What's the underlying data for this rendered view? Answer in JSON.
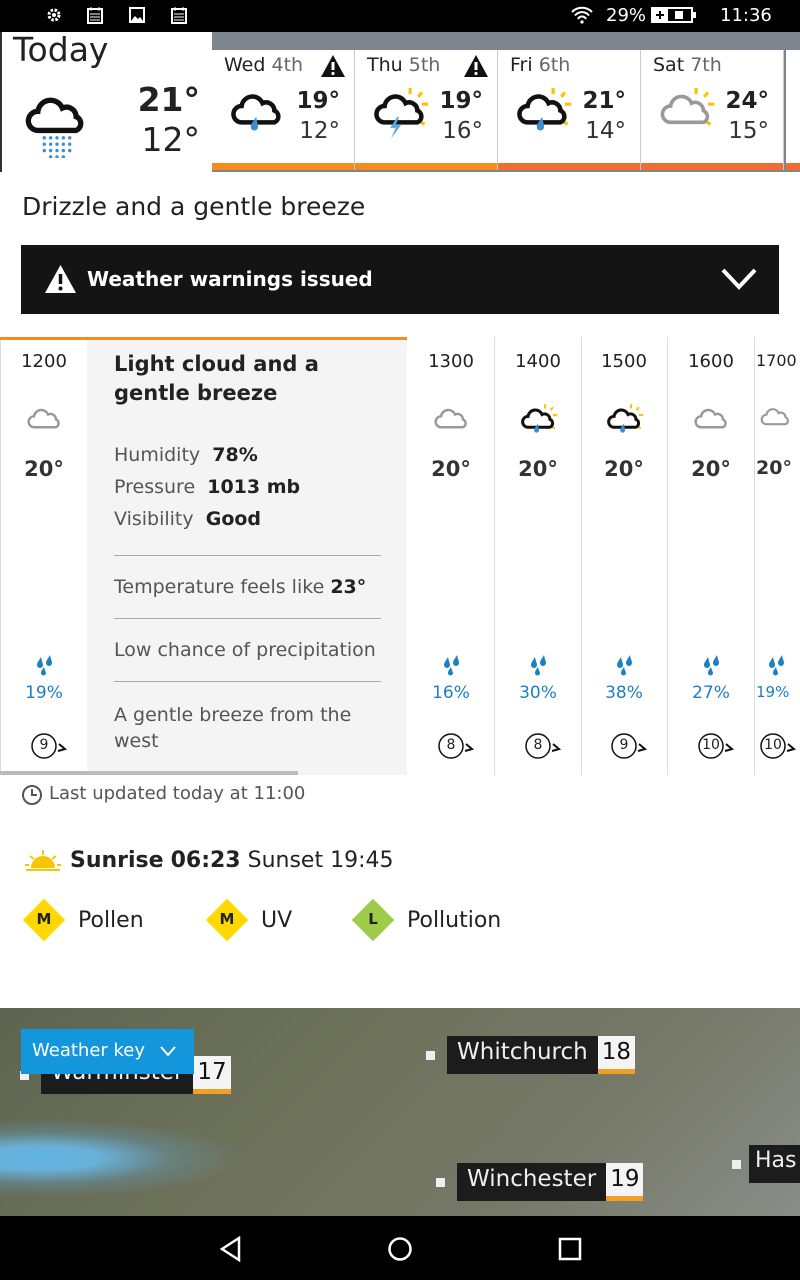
{
  "status_bar": {
    "icons": [
      "gear-icon",
      "calendar-icon",
      "image-icon",
      "calendar-icon"
    ],
    "battery": "29%",
    "time": "11:36"
  },
  "today": {
    "label": "Today",
    "high": "21°",
    "low": "12°",
    "icon": "drizzle"
  },
  "days": [
    {
      "day": "Wed",
      "date": "4th",
      "high": "19°",
      "low": "12°",
      "icon": "light-rain",
      "warning": true,
      "bar_color": "#f58b1f"
    },
    {
      "day": "Thu",
      "date": "5th",
      "high": "19°",
      "low": "16°",
      "icon": "thunder-sun",
      "warning": true,
      "bar_color": "#f58b1f"
    },
    {
      "day": "Fri",
      "date": "6th",
      "high": "21°",
      "low": "14°",
      "icon": "rain-sun",
      "warning": false,
      "bar_color": "#f26b30"
    },
    {
      "day": "Sat",
      "date": "7th",
      "high": "24°",
      "low": "15°",
      "icon": "cloud-sun",
      "warning": false,
      "bar_color": "#f26b30"
    }
  ],
  "summary": "Drizzle and a gentle breeze",
  "warning_bar": {
    "label": "Weather warnings issued"
  },
  "hourly": [
    {
      "time": "1200",
      "temp": "20°",
      "precip": "19%",
      "wind": "9",
      "icon": "cloud"
    },
    {
      "time": "1300",
      "temp": "20°",
      "precip": "16%",
      "wind": "8",
      "icon": "cloud"
    },
    {
      "time": "1400",
      "temp": "20°",
      "precip": "30%",
      "wind": "8",
      "icon": "rain-sun"
    },
    {
      "time": "1500",
      "temp": "20°",
      "precip": "38%",
      "wind": "9",
      "icon": "rain-sun"
    },
    {
      "time": "1600",
      "temp": "20°",
      "precip": "27%",
      "wind": "10",
      "icon": "cloud"
    },
    {
      "time": "1700",
      "temp": "20°",
      "precip": "19%",
      "wind": "10",
      "icon": "cloud"
    }
  ],
  "detail": {
    "title": "Light cloud and a gentle breeze",
    "humidity_label": "Humidity",
    "humidity": "78%",
    "pressure_label": "Pressure",
    "pressure": "1013 mb",
    "visibility_label": "Visibility",
    "visibility": "Good",
    "feels_label": "Temperature feels like",
    "feels": "23°",
    "precip_text": "Low chance of precipitation",
    "wind_text": "A gentle breeze from the west"
  },
  "last_updated": "Last updated today at 11:00",
  "sun": {
    "sunrise_label": "Sunrise",
    "sunrise": "06:23",
    "sunset_label": "Sunset",
    "sunset": "19:45"
  },
  "indices": [
    {
      "level": "M",
      "label": "Pollen",
      "color": "#ffd800"
    },
    {
      "level": "M",
      "label": "UV",
      "color": "#ffd800"
    },
    {
      "level": "L",
      "label": "Pollution",
      "color": "#9ccc4a"
    }
  ],
  "map": {
    "weather_key": "Weather key",
    "towns": [
      {
        "name": "Warminster",
        "temp": "17"
      },
      {
        "name": "Whitchurch",
        "temp": "18"
      },
      {
        "name": "Winchester",
        "temp": "19"
      },
      {
        "name": "Has",
        "temp": ""
      }
    ]
  }
}
